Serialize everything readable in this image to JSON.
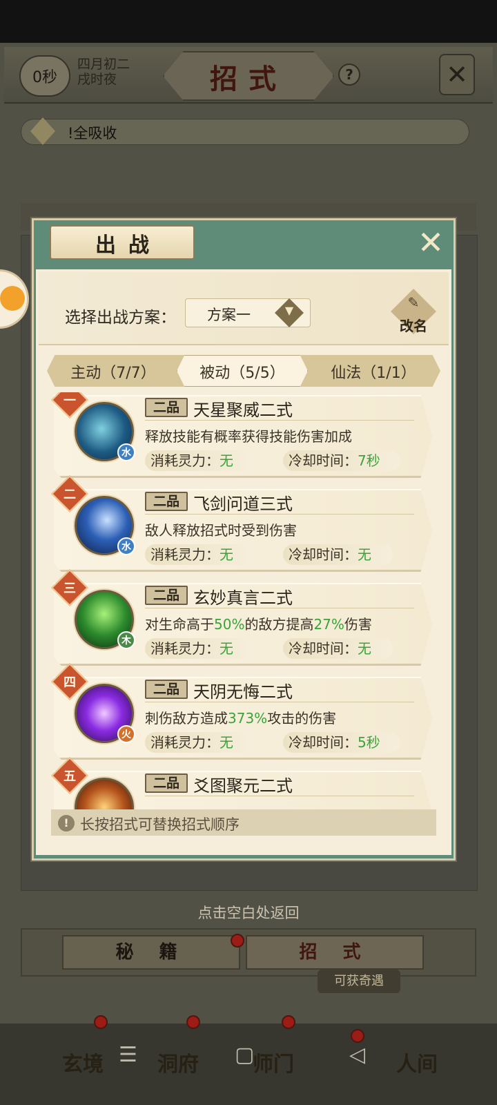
{
  "background": {
    "time_badge": "0秒",
    "date_line1": "四月初二",
    "date_line2": "戌时夜",
    "page_title": "招式",
    "help": "?",
    "notice": "!全吸收",
    "return_hint": "点击空白处返回",
    "bottom_tabs": [
      "秘 籍",
      "招 式"
    ],
    "reward_tag": "可获奇遇",
    "nav": [
      "玄境",
      "洞府",
      "师门",
      "人间"
    ]
  },
  "modal": {
    "title": "出战",
    "plan_label": "选择出战方案：",
    "plan_value": "方案一",
    "rename_label": "改名",
    "tabs": [
      {
        "label": "主动（7/7）",
        "active": false
      },
      {
        "label": "被动（5/5）",
        "active": true
      },
      {
        "label": "仙法（1/1）",
        "active": false
      }
    ],
    "cost_label": "消耗灵力：",
    "cooldown_label": "冷却时间：",
    "skills": [
      {
        "rank": "一",
        "grade": "二品",
        "name": "天星聚威二式",
        "element": "水",
        "element_color": "#3f7fc2",
        "desc": [
          "释放技能有概率获得技能伤害加成"
        ],
        "cost": "无",
        "cooldown": "7秒"
      },
      {
        "rank": "二",
        "grade": "二品",
        "name": "飞剑问道三式",
        "element": "水",
        "element_color": "#3f7fc2",
        "desc": [
          "敌人释放招式时受到伤害"
        ],
        "cost": "无",
        "cooldown": "无"
      },
      {
        "rank": "三",
        "grade": "二品",
        "name": "玄妙真言二式",
        "element": "木",
        "element_color": "#4d8a4a",
        "desc": [
          "对生命高于",
          "50%",
          "的敌方提高",
          "27%",
          "伤害"
        ],
        "cost": "无",
        "cooldown": "无"
      },
      {
        "rank": "四",
        "grade": "二品",
        "name": "天阴无悔二式",
        "element": "火",
        "element_color": "#d2712c",
        "desc": [
          "刺伤敌方造成",
          "373%",
          "攻击的伤害"
        ],
        "cost": "无",
        "cooldown": "5秒"
      },
      {
        "rank": "五",
        "grade": "二品",
        "name": "爻图聚元二式",
        "element": "",
        "element_color": "#c08a2a",
        "desc": [],
        "cost": "",
        "cooldown": ""
      }
    ],
    "hint": "长按招式可替换招式顺序"
  },
  "colors": {
    "accent_green": "#3aa33a",
    "modal_frame": "#5e8c78",
    "parchment": "#f6eedb",
    "rank_red": "#c9542d"
  }
}
